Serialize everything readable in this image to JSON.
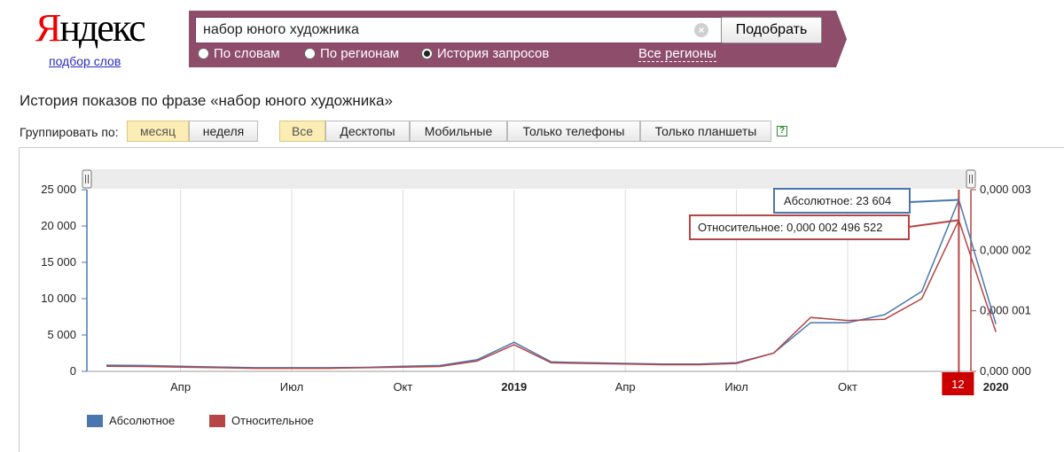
{
  "logo": {
    "first_letter": "Я",
    "rest": "ндекс",
    "subtitle": "подбор слов"
  },
  "search": {
    "query": "набор юного художника",
    "submit_label": "Подобрать",
    "clear_glyph": "×",
    "modes": [
      {
        "label": "По словам",
        "selected": false
      },
      {
        "label": "По регионам",
        "selected": false
      },
      {
        "label": "История запросов",
        "selected": true
      }
    ],
    "regions_link": "Все регионы"
  },
  "history_title": "История показов по фразе «набор юного художника»",
  "grouping": {
    "label": "Группировать по:",
    "options": [
      {
        "label": "месяц",
        "active": true
      },
      {
        "label": "неделя",
        "active": false
      }
    ]
  },
  "device_filter": {
    "options": [
      {
        "label": "Все",
        "active": true
      },
      {
        "label": "Десктопы",
        "active": false
      },
      {
        "label": "Мобильные",
        "active": false
      },
      {
        "label": "Только телефоны",
        "active": false
      },
      {
        "label": "Только планшеты",
        "active": false
      }
    ],
    "help_glyph": "?"
  },
  "colors": {
    "band": "#8f4d6c",
    "absolute": "#4a76b0",
    "relative": "#b64545"
  },
  "chart_data": {
    "type": "line",
    "x_ticks": [
      "Апр",
      "Июл",
      "Окт",
      "2019",
      "Апр",
      "Июл",
      "Окт",
      "12",
      "2020"
    ],
    "y_left_ticks": [
      "25 000",
      "20 000",
      "15 000",
      "10 000",
      "5 000",
      "0"
    ],
    "y_left_range": [
      0,
      25000
    ],
    "y_right_ticks": [
      "0,000 003",
      "0,000 002",
      "0,000 001",
      "0,000 000"
    ],
    "y_right_range": [
      0,
      3e-06
    ],
    "months": [
      "2018-02",
      "2018-03",
      "2018-04",
      "2018-05",
      "2018-06",
      "2018-07",
      "2018-08",
      "2018-09",
      "2018-10",
      "2018-11",
      "2018-12",
      "2019-01",
      "2019-02",
      "2019-03",
      "2019-04",
      "2019-05",
      "2019-06",
      "2019-07",
      "2019-08",
      "2019-09",
      "2019-10",
      "2019-11",
      "2019-12",
      "2020-01"
    ],
    "series": [
      {
        "name": "Абсолютное",
        "values": [
          850,
          800,
          700,
          600,
          500,
          500,
          500,
          550,
          700,
          800,
          1600,
          4000,
          1300,
          1200,
          1100,
          1000,
          1000,
          1200,
          2500,
          6700,
          6700,
          7800,
          11000,
          23604,
          6500
        ]
      },
      {
        "name": "Относительное",
        "values": [
          8.5e-08,
          8e-08,
          7e-08,
          6e-08,
          5e-08,
          5e-08,
          5e-08,
          6e-08,
          7e-08,
          8e-08,
          1.7e-07,
          4.4e-07,
          1.4e-07,
          1.3e-07,
          1.2e-07,
          1.1e-07,
          1.1e-07,
          1.3e-07,
          3e-07,
          8.9e-07,
          8.4e-07,
          8.6e-07,
          1.2e-06,
          2.496522e-06,
          6.5e-07
        ]
      }
    ],
    "tooltip_absolute": "Абсолютное: 23 604",
    "tooltip_relative": "Относительное: 0,000 002 496 522",
    "legend": [
      "Абсолютное",
      "Относительное"
    ]
  }
}
